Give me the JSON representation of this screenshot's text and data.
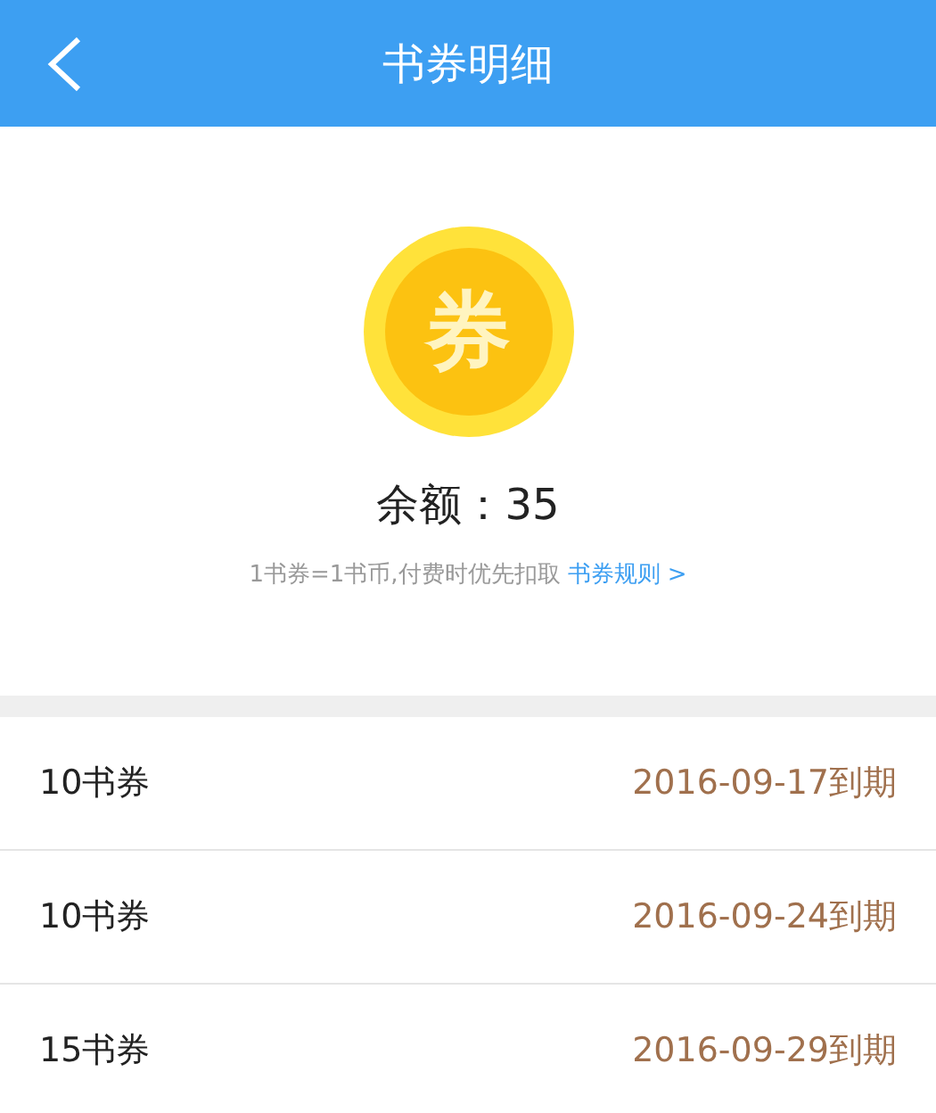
{
  "header": {
    "title": "书券明细"
  },
  "coin": {
    "glyph": "券"
  },
  "balance": "余额：35",
  "note": {
    "text": "1书券=1书币,付费时优先扣取",
    "link": "书券规则 >"
  },
  "vouchers": [
    {
      "name": "10书券",
      "expiry": "2016-09-17到期"
    },
    {
      "name": "10书券",
      "expiry": "2016-09-24到期"
    },
    {
      "name": "15书券",
      "expiry": "2016-09-29到期"
    }
  ]
}
